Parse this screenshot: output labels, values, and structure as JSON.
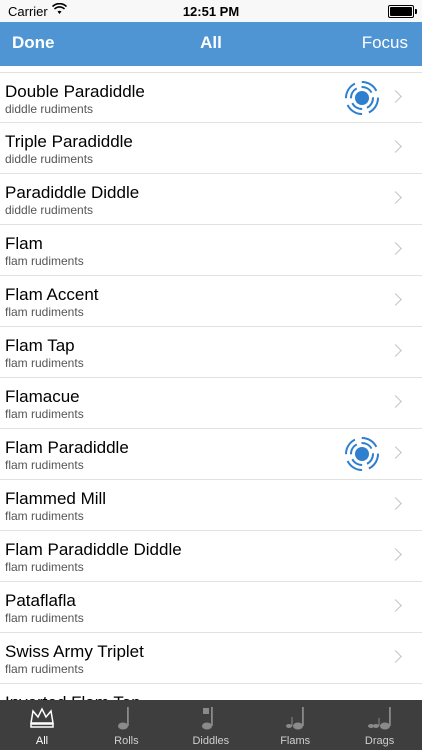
{
  "status": {
    "carrier": "Carrier",
    "time": "12:51 PM"
  },
  "nav": {
    "done": "Done",
    "title": "All",
    "focus": "Focus"
  },
  "rows": [
    {
      "name": "Double Paradiddle",
      "sub": "diddle rudiments",
      "focused": true
    },
    {
      "name": "Triple Paradiddle",
      "sub": "diddle rudiments"
    },
    {
      "name": "Paradiddle Diddle",
      "sub": "diddle rudiments"
    },
    {
      "name": "Flam",
      "sub": "flam rudiments"
    },
    {
      "name": "Flam Accent",
      "sub": "flam rudiments"
    },
    {
      "name": "Flam Tap",
      "sub": "flam rudiments"
    },
    {
      "name": "Flamacue",
      "sub": "flam rudiments"
    },
    {
      "name": "Flam Paradiddle",
      "sub": "flam rudiments",
      "focused": true
    },
    {
      "name": "Flammed Mill",
      "sub": "flam rudiments"
    },
    {
      "name": "Flam Paradiddle Diddle",
      "sub": "flam rudiments"
    },
    {
      "name": "Pataflafla",
      "sub": "flam rudiments"
    },
    {
      "name": "Swiss Army Triplet",
      "sub": "flam rudiments"
    },
    {
      "name": "Inverted Flam Tap",
      "sub": ""
    }
  ],
  "tabs": [
    {
      "label": "All",
      "icon": "crown-icon",
      "active": true
    },
    {
      "label": "Rolls",
      "icon": "note-icon"
    },
    {
      "label": "Diddles",
      "icon": "double-note-icon"
    },
    {
      "label": "Flams",
      "icon": "flam-note-icon"
    },
    {
      "label": "Drags",
      "icon": "drag-note-icon"
    }
  ],
  "colors": {
    "nav": "#4f95d3",
    "focus_icon": "#2f7fcf",
    "tab_bar": "#3e3e3e"
  }
}
